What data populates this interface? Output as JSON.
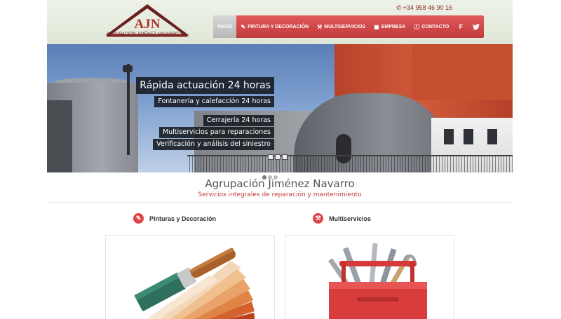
{
  "header": {
    "logo_text": "AJN",
    "logo_subtitle": "AGRUPACIÓN JIMÉNEZ NAVARRO S.L.",
    "phone": "+34 958 46 90 16"
  },
  "nav": {
    "items": [
      {
        "label": "Inicio",
        "icon": "none"
      },
      {
        "label": "Pintura y Decoración",
        "icon": "brush-icon"
      },
      {
        "label": "Multiservicios",
        "icon": "wrench-icon"
      },
      {
        "label": "Empresa",
        "icon": "briefcase-icon"
      },
      {
        "label": "Contacto",
        "icon": "info-icon"
      }
    ],
    "social": [
      "facebook-icon",
      "twitter-icon"
    ]
  },
  "slider": {
    "title": "Rápida actuación 24 horas",
    "lines": [
      "Fontanería y calefacción 24 horas",
      "Cerrajería 24 horas",
      "Multiservicios para reparaciones",
      "Verificación y análisis del siniestro"
    ]
  },
  "intro": {
    "title": "Agrupación Jiménez Navarro",
    "subtitle": "Servicios integrales de reparación y mantenimiento"
  },
  "services": [
    {
      "label": "Pinturas y Decoración",
      "icon": "brush-icon"
    },
    {
      "label": "Multiservicios",
      "icon": "wrench-icon"
    }
  ],
  "colors": {
    "accent": "#c23a3a",
    "header_bg": "#e6ebe0"
  }
}
